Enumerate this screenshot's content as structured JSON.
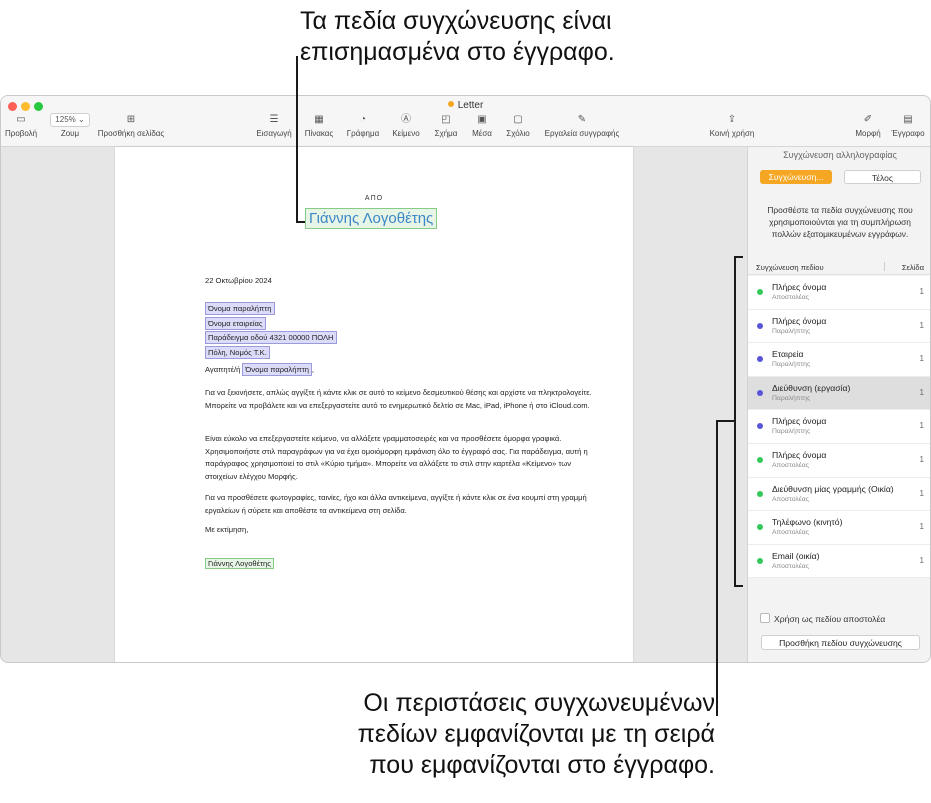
{
  "callouts": {
    "top": [
      "Τα πεδία συγχώνευσης είναι",
      "επισημασμένα στο έγγραφο."
    ],
    "bottom": [
      "Οι περιστάσεις συγχωνευμένων",
      "πεδίων εμφανίζονται με τη σειρά",
      "που εμφανίζονται στο έγγραφο."
    ]
  },
  "window": {
    "title": "Letter",
    "toolbar": {
      "view": "Προβολή",
      "zoom_value": "125%",
      "zoom": "Ζουμ",
      "add_page": "Προσθήκη σελίδας",
      "insert": "Εισαγωγή",
      "table": "Πίνακας",
      "chart": "Γράφημα",
      "text": "Κείμενο",
      "shape": "Σχήμα",
      "media": "Μέσα",
      "comment": "Σχόλιο",
      "writing_tools": "Εργαλεία συγγραφής",
      "share": "Κοινή χρήση",
      "format": "Μορφή",
      "document": "Έγγραφο"
    }
  },
  "document": {
    "from_label": "ΑΠΟ",
    "sender_name": "Γιάννης Λογοθέτης",
    "date": "22 Οκτωβρίου 2024",
    "recipient": [
      "Όνομα παραλήπτη",
      "Όνομα εταιρείας",
      "Παράδειγμα οδού 4321 00000 ΠΟΛΗ",
      "Πόλη, Νομός Τ.Κ."
    ],
    "greeting_prefix": "Αγαπητέ/ή",
    "greeting_field": "Όνομα παραλήπτη",
    "greeting_suffix": ",",
    "para1": "Για να ξεκινήσετε, απλώς αγγίξτε ή κάντε κλικ σε αυτό το κείμενο δεσμευτικού θέσης και αρχίστε να πληκτρολογείτε. Μπορείτε να προβάλετε και να επεξεργαστείτε αυτό το ενημερωτικό δελτίο σε Mac, iPad, iPhone ή στο iCloud.com.",
    "para2": "Είναι εύκολο να επεξεργαστείτε κείμενο, να αλλάξετε γραμματοσειρές και να προσθέσετε όμορφα γραφικά. Χρησιμοποιήστε στιλ παραγράφων για να έχει ομοιόμορφη εμφάνιση όλο το έγγραφό σας. Για παράδειγμα, αυτή η παράγραφος χρησιμοποιεί το στιλ «Κύριο τμήμα». Μπορείτε να αλλάξετε το στιλ στην καρτέλα «Κείμενο» των στοιχείων ελέγχου Μορφής.",
    "para3": "Για να προσθέσετε φωτογραφίες, ταινίες, ήχο και άλλα αντικείμενα, αγγίξτε ή κάντε κλικ σε ένα κουμπί στη γραμμή εργαλείων ή σύρετε και αποθέστε τα αντικείμενα στη σελίδα.",
    "closing": "Με εκτίμηση,",
    "signature": "Γιάννης Λογοθέτης"
  },
  "sidebar": {
    "title": "Συγχώνευση αλληλογραφίας",
    "merge_button": "Συγχώνευση...",
    "done_button": "Τέλος",
    "description": "Προσθέστε τα πεδία συγχώνευσης που χρησιμοποιούνται για τη συμπλήρωση πολλών εξατομικευμένων εγγράφων.",
    "col_field": "Συγχώνευση πεδίου",
    "col_page": "Σελίδα",
    "fields": [
      {
        "name": "Πλήρες όνομα",
        "role": "Αποστολέας",
        "page": "1",
        "color": "#34c759"
      },
      {
        "name": "Πλήρες όνομα",
        "role": "Παραλήπτης",
        "page": "1",
        "color": "#5856d6"
      },
      {
        "name": "Εταιρεία",
        "role": "Παραλήπτης",
        "page": "1",
        "color": "#5856d6"
      },
      {
        "name": "Διεύθυνση (εργασία)",
        "role": "Παραλήπτης",
        "page": "1",
        "color": "#5856d6"
      },
      {
        "name": "Πλήρες όνομα",
        "role": "Παραλήπτης",
        "page": "1",
        "color": "#5856d6"
      },
      {
        "name": "Πλήρες όνομα",
        "role": "Αποστολέας",
        "page": "1",
        "color": "#34c759"
      },
      {
        "name": "Διεύθυνση μίας γραμμής (Οικία)",
        "role": "Αποστολέας",
        "page": "1",
        "color": "#34c759"
      },
      {
        "name": "Τηλέφωνο (κινητό)",
        "role": "Αποστολέας",
        "page": "1",
        "color": "#34c759"
      },
      {
        "name": "Email (οικία)",
        "role": "Αποστολέας",
        "page": "1",
        "color": "#34c759"
      }
    ],
    "selected_index": 3,
    "use_as_sender": "Χρήση ως πεδίου αποστολέα",
    "add_field_button": "Προσθήκη πεδίου συγχώνευσης"
  }
}
